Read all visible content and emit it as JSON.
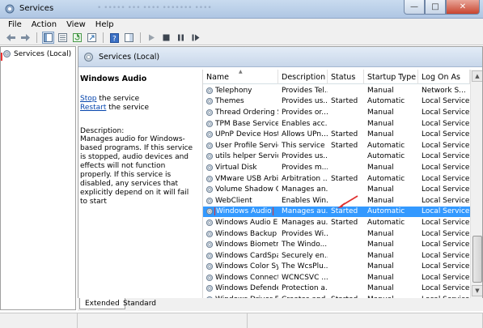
{
  "window": {
    "title": "Services",
    "ghost_tabs": "•  •••••  •••  ••••  •••••••  ••••"
  },
  "menu": [
    "File",
    "Action",
    "View",
    "Help"
  ],
  "tree": {
    "root_label": "Services (Local)"
  },
  "panel": {
    "header": "Services (Local)"
  },
  "detail": {
    "service_name": "Windows Audio",
    "stop_link": "Stop",
    "stop_suffix": " the service",
    "restart_link": "Restart",
    "restart_suffix": " the service",
    "description_label": "Description:",
    "description_text": "Manages audio for Windows-based programs.  If this service is stopped, audio devices and effects will not function properly.  If this service is disabled, any services that explicitly depend on it will fail to start"
  },
  "columns": {
    "name": "Name",
    "description": "Description",
    "status": "Status",
    "startup": "Startup Type",
    "logon": "Log On As"
  },
  "services": [
    {
      "name": "Telephony",
      "description": "Provides Tel...",
      "status": "",
      "startup": "Manual",
      "logon": "Network S..."
    },
    {
      "name": "Themes",
      "description": "Provides us...",
      "status": "Started",
      "startup": "Automatic",
      "logon": "Local Service"
    },
    {
      "name": "Thread Ordering S...",
      "description": "Provides or...",
      "status": "",
      "startup": "Manual",
      "logon": "Local Service"
    },
    {
      "name": "TPM Base Services",
      "description": "Enables acc...",
      "status": "",
      "startup": "Manual",
      "logon": "Local Service"
    },
    {
      "name": "UPnP Device Host",
      "description": "Allows UPn...",
      "status": "Started",
      "startup": "Manual",
      "logon": "Local Service"
    },
    {
      "name": "User Profile Service",
      "description": "This service ...",
      "status": "Started",
      "startup": "Automatic",
      "logon": "Local Service"
    },
    {
      "name": "utils helper Service",
      "description": "Provides us...",
      "status": "",
      "startup": "Automatic",
      "logon": "Local Service"
    },
    {
      "name": "Virtual Disk",
      "description": "Provides m...",
      "status": "",
      "startup": "Manual",
      "logon": "Local Service"
    },
    {
      "name": "VMware USB Arbit...",
      "description": "Arbitration ...",
      "status": "Started",
      "startup": "Automatic",
      "logon": "Local Service"
    },
    {
      "name": "Volume Shadow C...",
      "description": "Manages an...",
      "status": "",
      "startup": "Manual",
      "logon": "Local Service"
    },
    {
      "name": "WebClient",
      "description": "Enables Win...",
      "status": "",
      "startup": "Manual",
      "logon": "Local Service"
    },
    {
      "name": "Windows Audio",
      "description": "Manages au...",
      "status": "Started",
      "startup": "Automatic",
      "logon": "Local Service",
      "selected": true
    },
    {
      "name": "Windows Audio E...",
      "description": "Manages au...",
      "status": "Started",
      "startup": "Automatic",
      "logon": "Local Service"
    },
    {
      "name": "Windows Backup",
      "description": "Provides Wi...",
      "status": "",
      "startup": "Manual",
      "logon": "Local Service"
    },
    {
      "name": "Windows Biometri...",
      "description": "The Windo...",
      "status": "",
      "startup": "Manual",
      "logon": "Local Service"
    },
    {
      "name": "Windows CardSpa...",
      "description": "Securely en...",
      "status": "",
      "startup": "Manual",
      "logon": "Local Service"
    },
    {
      "name": "Windows Color Sy...",
      "description": "The WcsPlu...",
      "status": "",
      "startup": "Manual",
      "logon": "Local Service"
    },
    {
      "name": "Windows Connect...",
      "description": "WCNCSVC ...",
      "status": "",
      "startup": "Manual",
      "logon": "Local Service"
    },
    {
      "name": "Windows Defender",
      "description": "Protection a...",
      "status": "",
      "startup": "Manual",
      "logon": "Local Service"
    },
    {
      "name": "Windows Driver Fo...",
      "description": "Creates and...",
      "status": "Started",
      "startup": "Manual",
      "logon": "Local Service"
    }
  ],
  "tabs": [
    "Extended",
    "Standard"
  ],
  "colors": {
    "selection": "#3399ff",
    "annotation": "#e03030",
    "link": "#0645ad"
  },
  "icons": [
    "services-app-icon",
    "back-arrow-icon",
    "forward-arrow-icon",
    "console-tree-icon",
    "properties-icon",
    "refresh-icon",
    "export-icon",
    "help-icon",
    "show-hide-icon",
    "play-icon",
    "stop-icon",
    "pause-icon",
    "restart-icon",
    "gear-icon"
  ]
}
